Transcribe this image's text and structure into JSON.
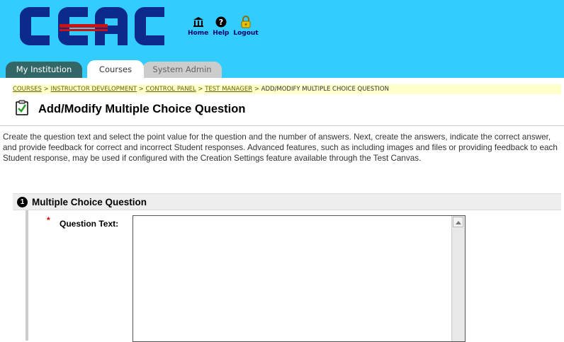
{
  "header": {
    "logo_text": "CCAC",
    "toplinks": [
      {
        "label": "Home",
        "icon": "institution-icon"
      },
      {
        "label": "Help",
        "icon": "help-icon"
      },
      {
        "label": "Logout",
        "icon": "lock-icon"
      }
    ]
  },
  "tabs": [
    {
      "label": "My Institution"
    },
    {
      "label": "Courses"
    },
    {
      "label": "System Admin"
    }
  ],
  "breadcrumb": {
    "items": [
      "COURSES",
      "INSTRUCTOR DEVELOPMENT",
      "CONTROL PANEL",
      "TEST MANAGER"
    ],
    "current": "ADD/MODIFY MULTIPLE CHOICE QUESTION",
    "separator": ">"
  },
  "page": {
    "title": "Add/Modify Multiple Choice Question",
    "instructions": "Create the question text and select the point value for the question and the number of answers. Next, create the answers, indicate the correct answer, and provide feedback for correct and incorrect Student responses. Advanced features, such as including images and files or providing feedback to each Student response, may be used if configured with the Creation Settings feature available through the Test Canvas."
  },
  "section": {
    "number": "1",
    "title": "Multiple Choice Question",
    "required_mark": "*",
    "question_label": "Question Text:",
    "question_value": ""
  },
  "colors": {
    "header_bg": "#33ccff",
    "logo_blue": "#0b2a8c",
    "logo_red": "#cc1111",
    "tab_active": "#ffffff",
    "tab_institution": "#336666",
    "breadcrumb_bg": "#ffffcc"
  }
}
